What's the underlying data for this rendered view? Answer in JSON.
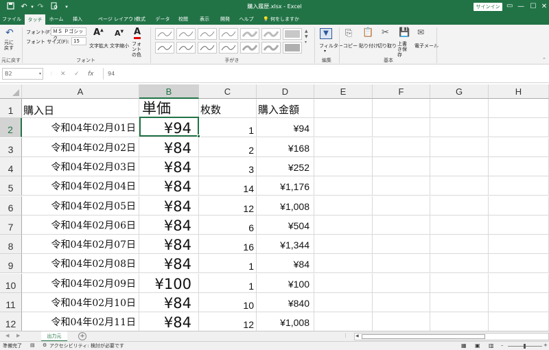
{
  "titlebar": {
    "doc_title": "購入履歴.xlsx - Excel",
    "signin": "サインイン"
  },
  "tabs": [
    "ファイル",
    "タッチ",
    "ホーム",
    "挿入",
    "ページ レイアウト",
    "数式",
    "データ",
    "校閲",
    "表示",
    "開発",
    "ヘルプ"
  ],
  "tell_me": "何をしますか",
  "ribbon": {
    "undo_label": "元に戻す",
    "undo_group": "元に戻す",
    "font_label": "フォント(F):",
    "font_value": "ＭＳ Ｐゴシック",
    "size_label": "フォント サイズ(F):",
    "size_value": "15",
    "grow_label": "文字拡大",
    "shrink_label": "文字縮小",
    "font_color_label": "フォントの色",
    "font_group": "フォント",
    "pen_group": "手がき",
    "filter_label": "フィルター",
    "edit_group": "編集",
    "copy_label": "コピー",
    "paste_label": "貼り付け",
    "cut_label": "切り取り",
    "save_label": "上書き保存",
    "email_label": "電子メール",
    "basic_group": "基本"
  },
  "formula_bar": {
    "name_box": "B2",
    "fx": "fx",
    "value": "94"
  },
  "columns": [
    "A",
    "B",
    "C",
    "D",
    "E",
    "F",
    "G",
    "H"
  ],
  "rows": [
    "1",
    "2",
    "3",
    "4",
    "5",
    "6",
    "7",
    "8",
    "9",
    "10",
    "11",
    "12"
  ],
  "header_row": {
    "a": "購入日",
    "b": "単価",
    "c": "枚数",
    "d": "購入金額"
  },
  "data_rows": [
    {
      "a": "令和04年02月01日",
      "b": "¥94",
      "c": "1",
      "d": "¥94"
    },
    {
      "a": "令和04年02月02日",
      "b": "¥84",
      "c": "2",
      "d": "¥168"
    },
    {
      "a": "令和04年02月03日",
      "b": "¥84",
      "c": "3",
      "d": "¥252"
    },
    {
      "a": "令和04年02月04日",
      "b": "¥84",
      "c": "14",
      "d": "¥1,176"
    },
    {
      "a": "令和04年02月05日",
      "b": "¥84",
      "c": "12",
      "d": "¥1,008"
    },
    {
      "a": "令和04年02月06日",
      "b": "¥84",
      "c": "6",
      "d": "¥504"
    },
    {
      "a": "令和04年02月07日",
      "b": "¥84",
      "c": "16",
      "d": "¥1,344"
    },
    {
      "a": "令和04年02月08日",
      "b": "¥84",
      "c": "1",
      "d": "¥84"
    },
    {
      "a": "令和04年02月09日",
      "b": "¥100",
      "c": "1",
      "d": "¥100"
    },
    {
      "a": "令和04年02月10日",
      "b": "¥84",
      "c": "10",
      "d": "¥840"
    },
    {
      "a": "令和04年02月11日",
      "b": "¥84",
      "c": "12",
      "d": "¥1,008"
    }
  ],
  "sheet_tabs": [
    "出力元"
  ],
  "status": {
    "ready": "準備完了",
    "accessibility": "アクセシビリティ: 検討が必要です"
  },
  "colors": {
    "accent": "#217346"
  }
}
